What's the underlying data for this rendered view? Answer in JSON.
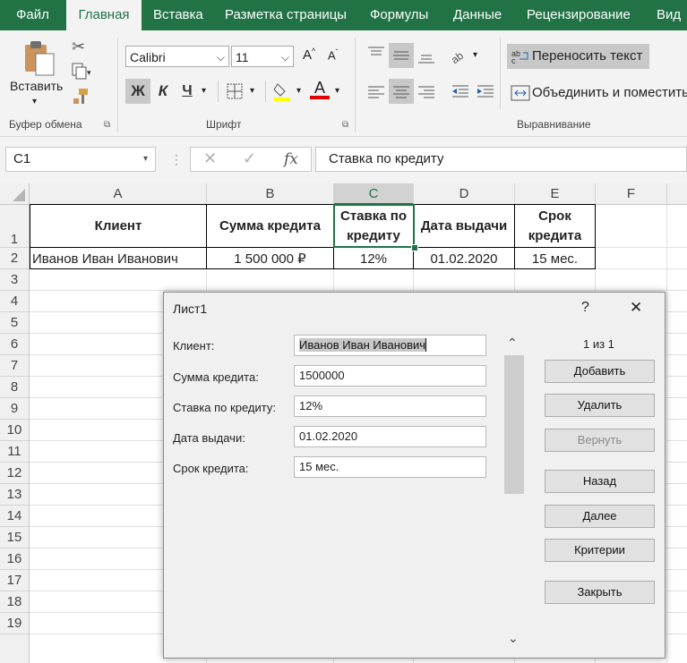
{
  "ribbon": {
    "tabs": [
      "Файл",
      "Главная",
      "Вставка",
      "Разметка страницы",
      "Формулы",
      "Данные",
      "Рецензирование",
      "Вид"
    ],
    "active_tab": "Главная",
    "clipboard": {
      "paste_label": "Вставить",
      "group_label": "Буфер обмена"
    },
    "font": {
      "name": "Calibri",
      "size": "11",
      "bold": "Ж",
      "italic": "К",
      "underline": "Ч",
      "group_label": "Шрифт",
      "grow": "A",
      "shrink": "A",
      "font_color_letter": "A"
    },
    "alignment": {
      "wrap_text": "Переносить текст",
      "merge": "Объединить и поместить",
      "group_label": "Выравнивание"
    },
    "colors": {
      "accent": "#217346",
      "highlight": "#ffff00",
      "font_color": "#e00000"
    }
  },
  "formula_bar": {
    "name_box": "C1",
    "fx": "fx",
    "formula": "Ставка по кредиту"
  },
  "sheet": {
    "columns": [
      "A",
      "B",
      "C",
      "D",
      "E",
      "F"
    ],
    "selected_column": "C",
    "rows": [
      "1",
      "2",
      "3",
      "4",
      "5",
      "6",
      "7",
      "8",
      "9",
      "10",
      "11",
      "12",
      "13",
      "14",
      "15",
      "16",
      "17",
      "18",
      "19"
    ],
    "headers": [
      "Клиент",
      "Сумма кредита",
      "Ставка по кредиту",
      "Дата выдачи",
      "Срок кредита"
    ],
    "row2": [
      "Иванов Иван Иванович",
      "1 500 000 ₽",
      "12%",
      "01.02.2020",
      "15 мес."
    ]
  },
  "dialog": {
    "title": "Лист1",
    "help": "?",
    "close": "✕",
    "record_counter": "1 из 1",
    "fields": [
      {
        "label": "Клиент:",
        "value": "Иванов Иван Иванович"
      },
      {
        "label": "Сумма кредита:",
        "value": "1500000"
      },
      {
        "label": "Ставка по кредиту:",
        "value": "12%"
      },
      {
        "label": "Дата выдачи:",
        "value": "01.02.2020"
      },
      {
        "label": "Срок кредита:",
        "value": "15 мес."
      }
    ],
    "buttons": {
      "add": "Добавить",
      "delete": "Удалить",
      "restore": "Вернуть",
      "prev": "Назад",
      "next": "Далее",
      "criteria": "Критерии",
      "close": "Закрыть"
    }
  }
}
